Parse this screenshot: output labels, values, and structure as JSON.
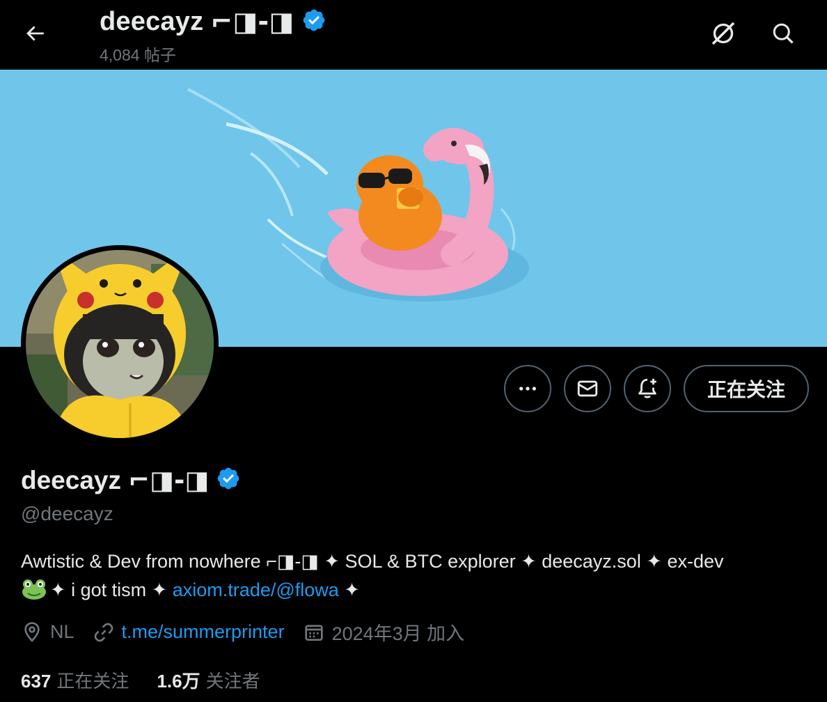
{
  "header": {
    "name": "deecayz",
    "name_glyphs": "⌐◨-◨",
    "post_count": "4,084 帖子"
  },
  "profile": {
    "name": "deecayz",
    "name_glyphs": "⌐◨-◨",
    "handle": "@deecayz",
    "bio_line1": "Awtistic & Dev from nowhere ⌐◨-◨ ✦ SOL & BTC explorer ✦ deecayz.sol ✦ ex-dev",
    "bio_line2_pre": "✦ i got tism ✦ ",
    "bio_link": "axiom.trade/@flowa",
    "bio_line2_post": " ✦",
    "location": "NL",
    "website": "t.me/summerprinter",
    "joined": "2024年3月 加入",
    "following_count": "637",
    "following_label": "正在关注",
    "followers_count": "1.6万",
    "followers_label": "关注者"
  },
  "actions": {
    "follow_label": "正在关注"
  },
  "icons": {
    "back": "arrow-left-icon",
    "grok": "grok-icon",
    "search": "search-icon",
    "more": "more-dots-icon",
    "message": "envelope-icon",
    "notify": "bell-plus-icon",
    "verified": "verified-badge-icon",
    "location": "location-pin-icon",
    "link": "link-icon",
    "calendar": "calendar-icon"
  },
  "colors": {
    "background": "#000000",
    "text": "#e7e9ea",
    "secondary_text": "#71767b",
    "accent": "#1d9bf0",
    "banner": "#6fc6ea",
    "button_border": "#536471"
  }
}
